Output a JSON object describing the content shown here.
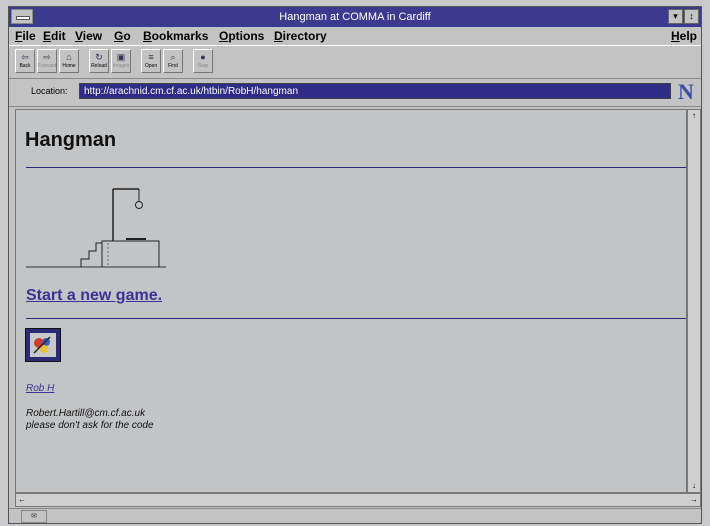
{
  "window": {
    "title": "Hangman at COMMA in Cardiff",
    "controls": [
      "▾",
      "↕"
    ]
  },
  "menubar": {
    "items": [
      {
        "label": "File"
      },
      {
        "label": "Edit"
      },
      {
        "label": "View"
      },
      {
        "label": "Go"
      },
      {
        "label": "Bookmarks"
      },
      {
        "label": "Options"
      },
      {
        "label": "Directory"
      }
    ],
    "help": "Help"
  },
  "toolbar": {
    "buttons": [
      {
        "label": "Back",
        "icon": "back-icon",
        "glyph": "⇦",
        "enabled": true
      },
      {
        "label": "Forward",
        "icon": "forward-icon",
        "glyph": "⇨",
        "enabled": false
      },
      {
        "label": "Home",
        "icon": "home-icon",
        "glyph": "⌂",
        "enabled": true
      },
      {
        "label": "Reload",
        "icon": "reload-icon",
        "glyph": "↻",
        "enabled": true
      },
      {
        "label": "Images",
        "icon": "images-icon",
        "glyph": "▣",
        "enabled": false
      },
      {
        "label": "Open",
        "icon": "open-icon",
        "glyph": "≡",
        "enabled": true
      },
      {
        "label": "Find",
        "icon": "find-icon",
        "glyph": "⌕",
        "enabled": true
      },
      {
        "label": "Stop",
        "icon": "stop-icon",
        "glyph": "●",
        "enabled": false
      }
    ]
  },
  "location": {
    "label": "Location:",
    "url": "http://arachnid.cm.cf.ac.uk/htbin/RobH/hangman"
  },
  "logo": {
    "glyph": "N"
  },
  "page": {
    "heading": "Hangman",
    "new_game_link": "Start a new game.",
    "author_link": "Rob H",
    "email": "Robert.Hartill@cm.cf.ac.uk",
    "note": "please don't ask for the code"
  },
  "scroll": {
    "up": "↑",
    "down": "↓",
    "left": "←",
    "right": "→"
  },
  "status": {
    "icon_glyph": "✉"
  },
  "colors": {
    "title_bar": "#3c3a8e",
    "link": "#3a3296",
    "url_field": "#2e2c86"
  }
}
